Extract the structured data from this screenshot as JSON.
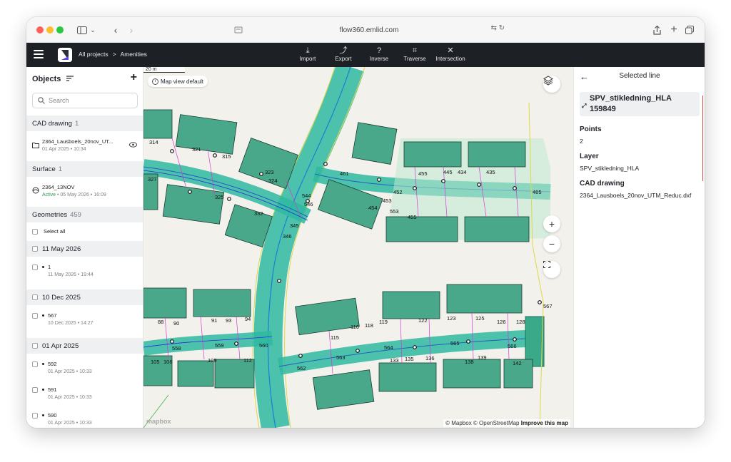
{
  "browser": {
    "url": "flow360.emlid.com"
  },
  "appbar": {
    "breadcrumb": [
      "All projects",
      ">",
      "Amenities"
    ],
    "tools": [
      {
        "label": "Import",
        "icon": "import-icon"
      },
      {
        "label": "Export",
        "icon": "export-icon"
      },
      {
        "label": "Inverse",
        "icon": "inverse-icon"
      },
      {
        "label": "Traverse",
        "icon": "traverse-icon"
      },
      {
        "label": "Intersection",
        "icon": "intersection-icon"
      }
    ]
  },
  "sidebar": {
    "title": "Objects",
    "search_placeholder": "Search",
    "cad": {
      "label": "CAD drawing",
      "count": "1",
      "file": "2364_Lausboels_20nov_UT...",
      "date": "01 Apr 2025 • 10:34"
    },
    "surface": {
      "label": "Surface",
      "count": "1",
      "name": "2364_13NOV",
      "status": "Active",
      "date": " • 05 May 2026 • 16:09"
    },
    "geometries": {
      "label": "Geometries",
      "count": "459",
      "select_all": "Select all"
    },
    "groups": [
      {
        "header": "11 May 2026",
        "items": [
          {
            "name": "1",
            "date": "11 May 2026 • 19:44"
          }
        ]
      },
      {
        "header": "10 Dec 2025",
        "items": [
          {
            "name": "567",
            "date": "10 Dec 2025 • 14:27"
          }
        ]
      },
      {
        "header": "01 Apr 2025",
        "items": [
          {
            "name": "592",
            "date": "01 Apr 2025 • 10:33"
          },
          {
            "name": "591",
            "date": "01 Apr 2025 • 10:33"
          },
          {
            "name": "590",
            "date": "01 Apr 2025 • 10:33"
          }
        ]
      }
    ]
  },
  "map": {
    "view_chip": "Map view default",
    "scale": "20 m",
    "attribution_prefix": "© Mapbox © OpenStreetMap",
    "attribution_link": "Improve this map",
    "logo": "mapbox",
    "labels": [
      "314",
      "321",
      "315",
      "327",
      "323",
      "324",
      "325",
      "332",
      "544",
      "345",
      "346",
      "455",
      "461",
      "452",
      "453",
      "454",
      "445",
      "455",
      "434",
      "435",
      "465",
      "546",
      "553",
      "88",
      "90",
      "91",
      "93",
      "94",
      "558",
      "559",
      "560",
      "115",
      "116",
      "118",
      "119",
      "122",
      "123",
      "125",
      "126",
      "128",
      "564",
      "565",
      "566",
      "562",
      "563",
      "105",
      "106",
      "109",
      "112",
      "133",
      "135",
      "136",
      "138",
      "139",
      "142",
      "567"
    ]
  },
  "panel": {
    "title": "Selected line",
    "line_name": "SPV_stikledning_HLA 159849",
    "points_label": "Points",
    "points_value": "2",
    "layer_label": "Layer",
    "layer_value": "SPV_stikledning_HLA",
    "cad_label": "CAD drawing",
    "cad_value": "2364_Lausboels_20nov_UTM_Reduc.dxf"
  }
}
